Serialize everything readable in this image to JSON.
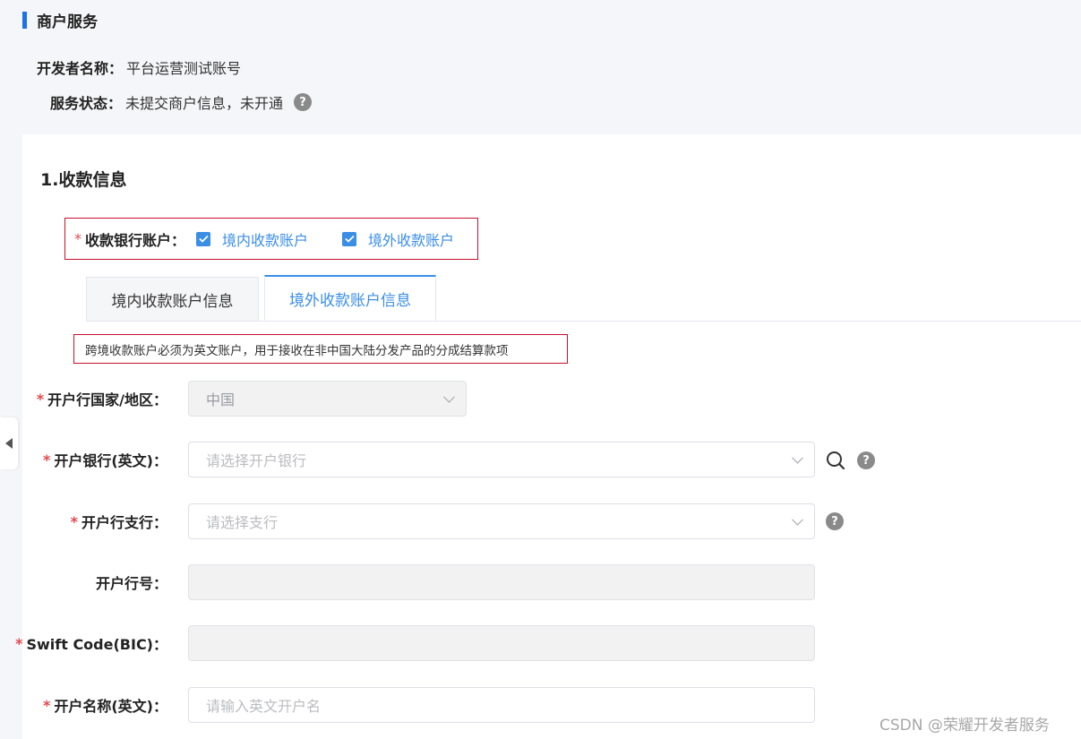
{
  "section": {
    "title": "商户服务"
  },
  "developer": {
    "label": "开发者名称：",
    "value": "平台运营测试账号"
  },
  "service_status": {
    "label": "服务状态：",
    "value": "未提交商户信息，未开通",
    "help": "?"
  },
  "receipt": {
    "title": "1.收款信息",
    "bank_accounts": {
      "required_mark": "*",
      "label": "收款银行账户：",
      "options": [
        {
          "label": "境内收款账户",
          "checked": true
        },
        {
          "label": "境外收款账户",
          "checked": true
        }
      ]
    },
    "tabs": [
      {
        "label": "境内收款账户信息",
        "active": false
      },
      {
        "label": "境外收款账户信息",
        "active": true
      }
    ],
    "notice": "跨境收款账户必须为英文账户，用于接收在非中国大陆分发产品的分成结算款项"
  },
  "form": {
    "country": {
      "required_mark": "*",
      "label": "开户行国家/地区：",
      "value": "中国"
    },
    "bank": {
      "required_mark": "*",
      "label": "开户银行(英文)：",
      "placeholder": "请选择开户银行",
      "help": "?"
    },
    "branch": {
      "required_mark": "*",
      "label": "开户行支行：",
      "placeholder": "请选择支行",
      "help": "?"
    },
    "bank_number": {
      "label": "开户行号：",
      "value": ""
    },
    "swift": {
      "required_mark": "*",
      "label": "Swift Code(BIC)：",
      "value": ""
    },
    "account_name": {
      "required_mark": "*",
      "label": "开户名称(英文)：",
      "placeholder": "请输入英文开户名"
    }
  },
  "watermark": "CSDN @荣耀开发者服务",
  "colors": {
    "accent": "#3a8ee6",
    "required": "#e5484d",
    "highlight_border": "#c8102e",
    "section_bar": "#1a73e8"
  },
  "icons": {
    "checkbox": "check-icon",
    "search": "search-icon",
    "help": "help-circle-icon",
    "select": "chevron-down-icon",
    "collapse": "caret-left-icon"
  }
}
